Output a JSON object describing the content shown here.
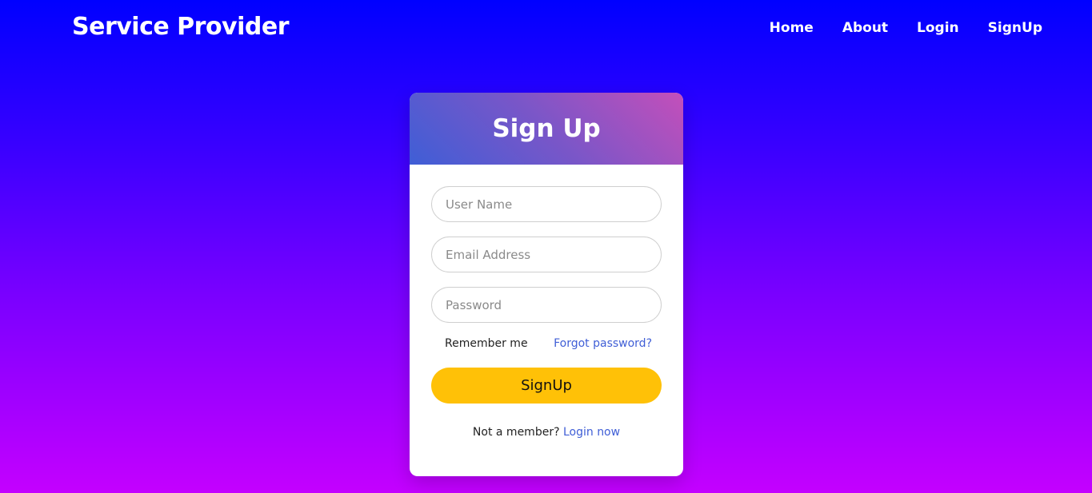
{
  "brand": {
    "name": "Service Provider"
  },
  "nav": {
    "items": [
      {
        "label": "Home"
      },
      {
        "label": "About"
      },
      {
        "label": "Login"
      },
      {
        "label": "SignUp"
      }
    ]
  },
  "form": {
    "title": "Sign Up",
    "username": {
      "placeholder": "User Name",
      "value": ""
    },
    "email": {
      "placeholder": "Email Address",
      "value": ""
    },
    "password": {
      "placeholder": "Password",
      "value": ""
    },
    "remember_label": "Remember me",
    "forgot_label": "Forgot password?",
    "submit_label": "SignUp",
    "footer_text": "Not a member?",
    "footer_link": "Login now"
  },
  "colors": {
    "accent_button": "#ffc107",
    "link": "#3f5ed6"
  }
}
